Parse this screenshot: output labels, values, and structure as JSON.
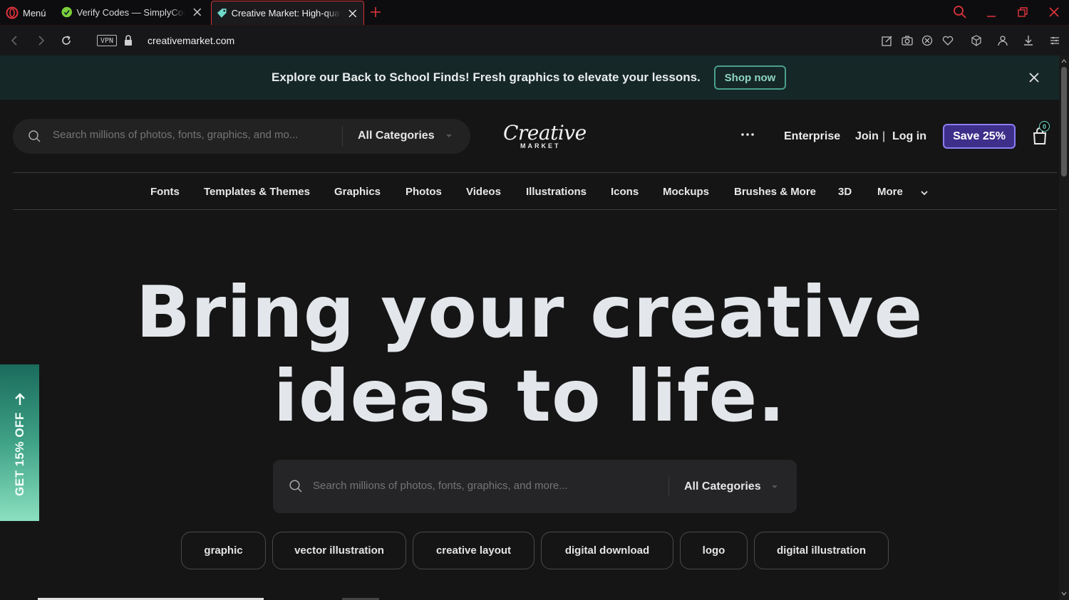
{
  "browser": {
    "menu_label": "Menú",
    "tabs": [
      {
        "title": "Verify Codes — SimplyCodes",
        "icon": "simplycodes-favicon"
      },
      {
        "title": "Creative Market: High-quality",
        "icon": "creative-market-favicon"
      }
    ],
    "url": "creativemarket.com",
    "vpn_label": "VPN"
  },
  "promo": {
    "text": "Explore our Back to School Finds! Fresh graphics to elevate your lessons.",
    "button": "Shop now"
  },
  "header": {
    "search_placeholder": "Search millions of photos, fonts, graphics, and mo...",
    "category_label": "All Categories",
    "logo_main": "Creative",
    "logo_sub": "MARKET",
    "enterprise": "Enterprise",
    "join": "Join",
    "separator": "|",
    "login": "Log in",
    "save_button": "Save 25%",
    "cart_count": "0"
  },
  "nav": {
    "items": [
      "Fonts",
      "Templates & Themes",
      "Graphics",
      "Photos",
      "Videos",
      "Illustrations",
      "Icons",
      "Mockups",
      "Brushes & More",
      "3D",
      "More"
    ]
  },
  "hero": {
    "line1": "Bring your creative",
    "line2": "ideas to life.",
    "search_placeholder": "Search millions of photos, fonts, graphics, and more...",
    "category_label": "All Categories",
    "chips": [
      "graphic",
      "vector illustration",
      "creative layout",
      "digital download",
      "logo",
      "digital illustration"
    ]
  },
  "side_promo": {
    "text": "GET 15% OFF"
  },
  "colors": {
    "accent_purple": "#3e2f8a",
    "accent_teal": "#4aa08a",
    "banner_bg": "#162728",
    "page_bg": "#151515"
  }
}
